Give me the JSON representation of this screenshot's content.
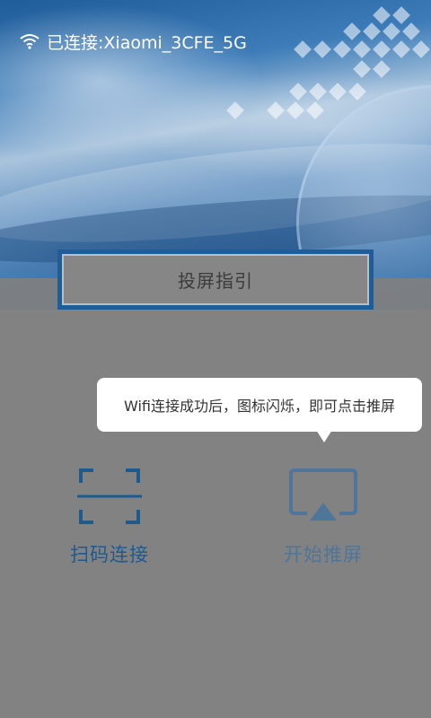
{
  "status_bar": {
    "icon": "wifi-icon",
    "connection_text": "已连接:Xiaomi_3CFE_5G"
  },
  "guide": {
    "label": "投屏指引"
  },
  "tooltip": {
    "text": "Wifi连接成功后，图标闪烁，即可点击推屏"
  },
  "actions": {
    "scan": {
      "icon": "qr-scan-icon",
      "label": "扫码连接"
    },
    "cast": {
      "icon": "airplay-icon",
      "label": "开始推屏"
    }
  },
  "colors": {
    "accent_blue": "#1d5a8e",
    "cast_blue": "#4f7599",
    "overlay_gray": "#828282"
  }
}
